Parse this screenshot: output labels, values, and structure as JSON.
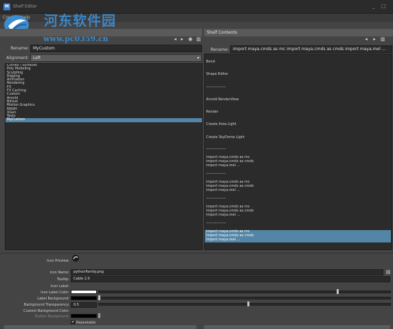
{
  "window": {
    "title": "Shelf Editor",
    "min": "_",
    "max": "□"
  },
  "menubar": {
    "items": [
      "Create",
      "Help"
    ]
  },
  "watermark": {
    "name": "河东软件园",
    "url": "www.pc0359.cn"
  },
  "left_panel": {
    "rename_label": "Rename:",
    "rename_value": "MyCustom",
    "alignment_label": "Alignment:",
    "alignment_value": "Left",
    "shelves": [
      "Curves / Surfaces",
      "Poly Modeling",
      "Sculpting",
      "Rigging",
      "Animation",
      "Rendering",
      "FX",
      "FX Caching",
      "Custom",
      "Arnold",
      "Bifrost",
      "Motion Graphics",
      "MASH",
      "XGen",
      "Tests",
      "MyCustom"
    ],
    "selected_shelf": "MyCustom"
  },
  "right_panel": {
    "header": "Shelf Contents",
    "rename_label": "Rename:",
    "rename_value": "import maya.cmds as mc import maya.cmds as cmds import maya.mel ...",
    "items": [
      "Bend",
      "Shape Editor",
      "----------------",
      "Arnold RenderView",
      "Render",
      "Create Area Light",
      "Create SkyDome Light",
      "----------------"
    ],
    "script_line_1": "import maya.cmds as mc",
    "script_line_2": "import maya.cmds as cmds",
    "script_line_3": "import maya.mel ...",
    "separator": "----------------"
  },
  "bottom": {
    "icon_preview_label": "Icon Preview:",
    "icon_name_label": "Icon Name:",
    "icon_name_value": "pythonFamily.png",
    "tooltip_label": "Tooltip:",
    "tooltip_value": "Cable 2.0",
    "icon_label_label": "Icon Label:",
    "icon_label_color_label": "Icon Label Color:",
    "label_background_label": "Label Background:",
    "background_transparency_label": "Background Transparency:",
    "background_transparency_value": "0.5",
    "custom_background_color_label": "Custom Background Color:",
    "button_background_label": "Button Background:",
    "repeatable_label": "Repeatable",
    "repeatable_checked": "✔"
  }
}
